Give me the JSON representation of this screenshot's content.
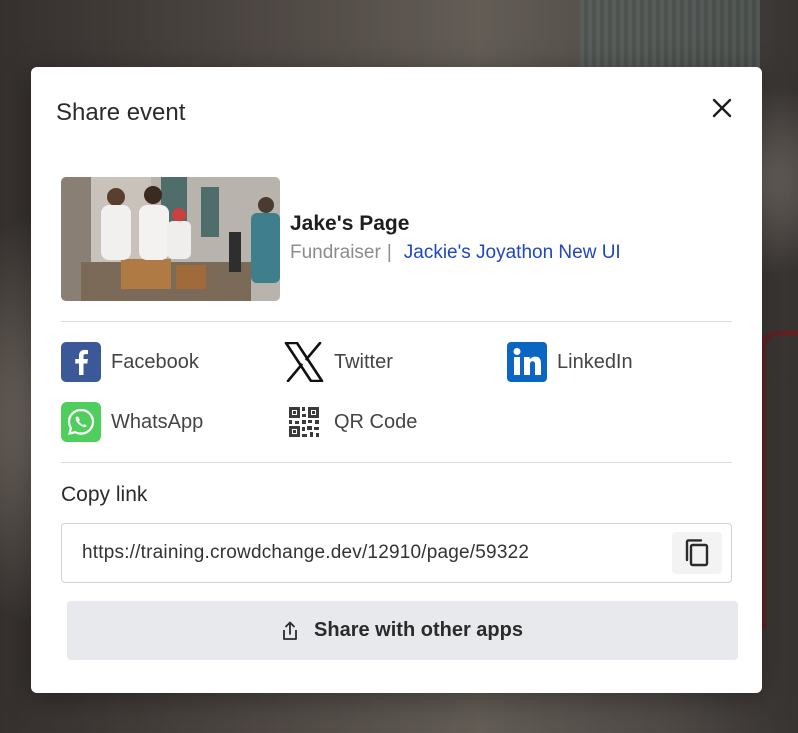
{
  "modal": {
    "title": "Share event",
    "close_icon": "close-icon"
  },
  "page": {
    "name": "Jake's Page",
    "type": "Fundraiser",
    "separator": "|",
    "event_name": "Jackie's Joyathon New UI",
    "thumbnail_icon": "fundraiser-photo"
  },
  "share_options": [
    {
      "label": "Facebook",
      "icon": "facebook-icon"
    },
    {
      "label": "Twitter",
      "icon": "x-twitter-icon"
    },
    {
      "label": "LinkedIn",
      "icon": "linkedin-icon"
    },
    {
      "label": "WhatsApp",
      "icon": "whatsapp-icon"
    },
    {
      "label": "QR Code",
      "icon": "qr-code-icon"
    }
  ],
  "copy_link": {
    "label": "Copy link",
    "url": "https://training.crowdchange.dev/12910/page/59322",
    "copy_icon": "copy-icon"
  },
  "share_other": {
    "label": "Share with other apps",
    "icon": "share-icon"
  },
  "colors": {
    "facebook": "#3b5998",
    "linkedin": "#0a66c2",
    "whatsapp": "#4fce5d",
    "link": "#1f46c4",
    "button_bg": "#e8e9ec"
  }
}
